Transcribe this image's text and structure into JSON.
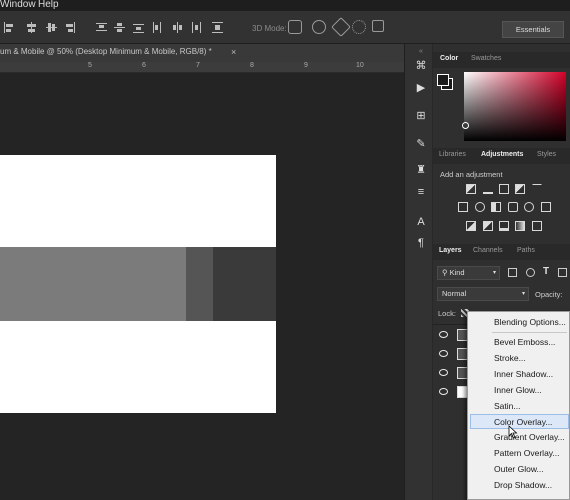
{
  "menubar": {
    "items": [
      "Window",
      "Help"
    ]
  },
  "optionsbar": {
    "mode_label": "3D Mode:",
    "workspace": "Essentials"
  },
  "document": {
    "tab_title": "um & Mobile @ 50% (Desktop Minimum & Mobile, RGB/8) *",
    "close": "×",
    "ruler_ticks": [
      "5",
      "6",
      "7",
      "8",
      "9",
      "10"
    ]
  },
  "panels": {
    "color_tabs": [
      "Color",
      "Swatches"
    ],
    "adj_tabs": [
      "Libraries",
      "Adjustments",
      "Styles"
    ],
    "add_adjustment": "Add an adjustment",
    "layers_tabs": [
      "Layers",
      "Channels",
      "Paths"
    ],
    "kind": "Kind",
    "blend_mode": "Normal",
    "opacity_label": "Opacity:",
    "lock_label": "Lock:"
  },
  "context_menu": {
    "items": [
      "Blending Options...",
      "Bevel  Emboss...",
      "Stroke...",
      "Inner Shadow...",
      "Inner Glow...",
      "Satin...",
      "Color Overlay...",
      "Gradient Overlay...",
      "Pattern Overlay...",
      "Outer Glow...",
      "Drop Shadow..."
    ],
    "hovered": "Color Overlay..."
  },
  "colors": {
    "accent_highlight": "#dce8f7",
    "canvas_white": "#ffffff",
    "panel_bg": "#2f2f2f"
  }
}
